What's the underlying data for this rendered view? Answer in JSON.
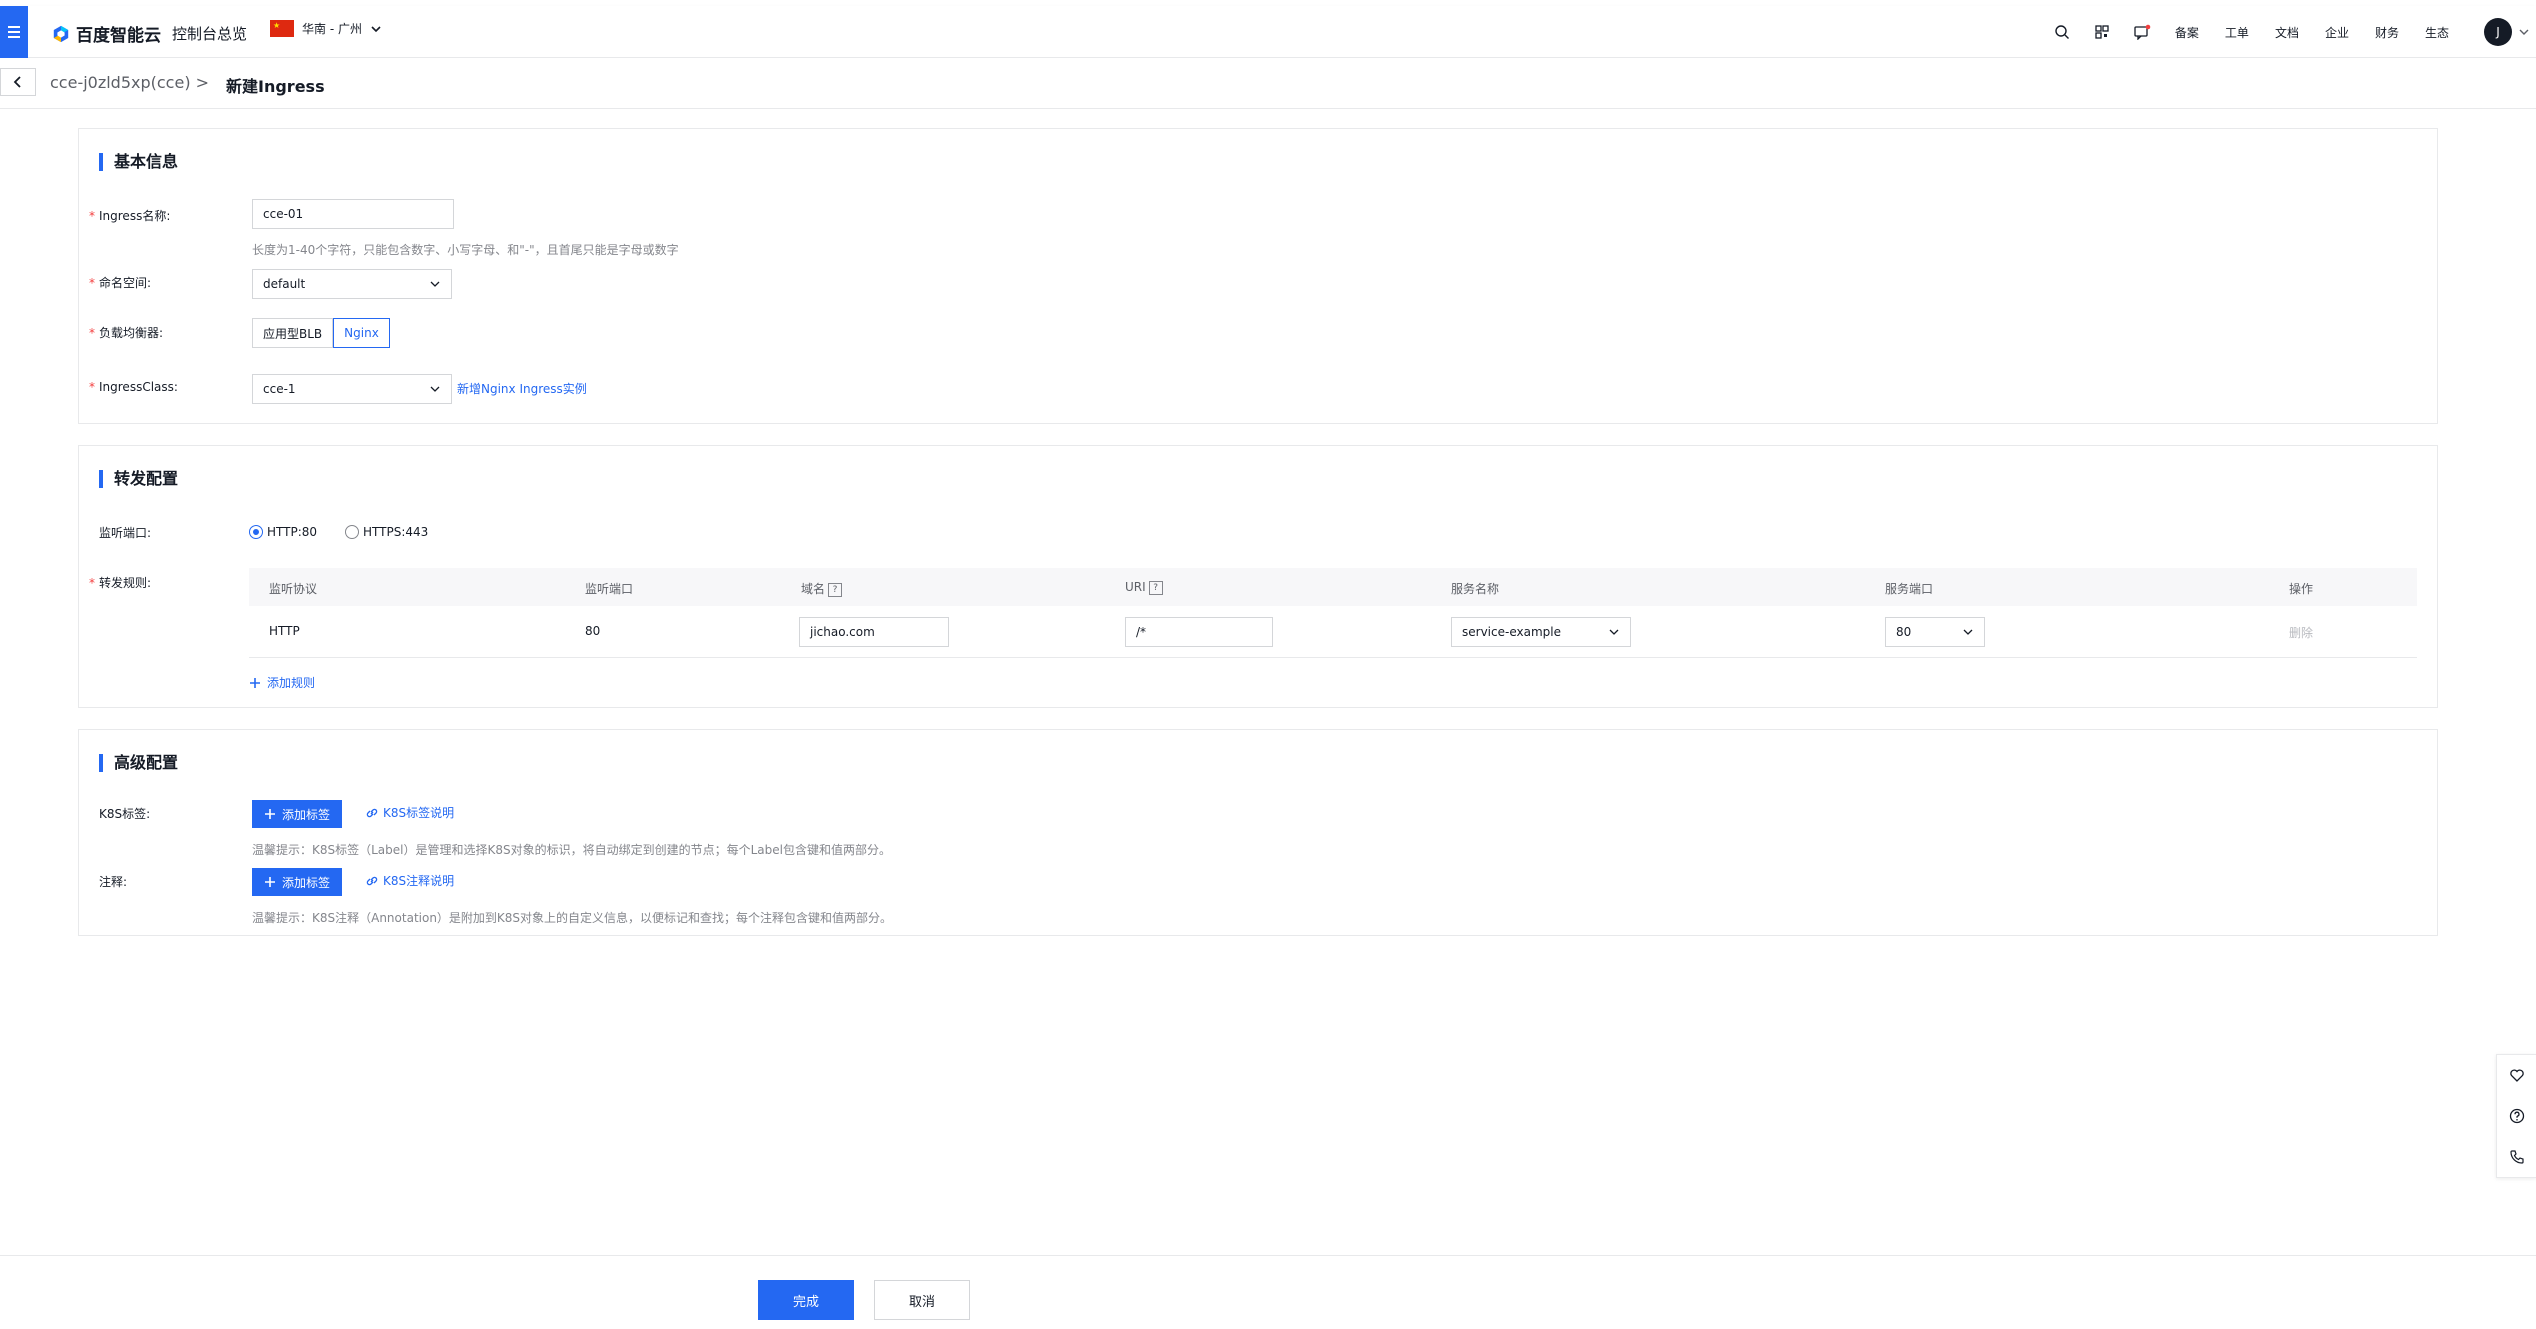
{
  "topbar": {
    "brand": "百度智能云",
    "console": "控制台总览",
    "region": "华南 - 广州",
    "links": [
      "备案",
      "工单",
      "文档",
      "企业",
      "财务",
      "生态"
    ],
    "avatar": "J",
    "icons": [
      "search-icon",
      "qrcode-icon",
      "message-icon"
    ]
  },
  "breadcrumb": {
    "parent": "cce-j0zld5xp(cce) >",
    "current": "新建Ingress"
  },
  "basic": {
    "title": "基本信息",
    "name_label": "Ingress名称:",
    "name_value": "cce-01",
    "name_hint": "长度为1-40个字符，只能包含数字、小写字母、和\"-\"，且首尾只能是字母或数字",
    "ns_label": "命名空间:",
    "ns_value": "default",
    "lb_label": "负载均衡器:",
    "lb_options": [
      "应用型BLB",
      "Nginx"
    ],
    "lb_selected": "Nginx",
    "class_label": "IngressClass:",
    "class_value": "cce-1",
    "class_link": "新增Nginx Ingress实例"
  },
  "forward": {
    "title": "转发配置",
    "port_label": "监听端口:",
    "ports": [
      "HTTP:80",
      "HTTPS:443"
    ],
    "port_selected": "HTTP:80",
    "rules_label": "转发规则:",
    "columns": [
      "监听协议",
      "监听端口",
      "域名",
      "URI",
      "服务名称",
      "服务端口",
      "操作"
    ],
    "row": {
      "protocol": "HTTP",
      "port": "80",
      "domain": "jichao.com",
      "uri": "/*",
      "service": "service-example",
      "service_port": "80",
      "action": "删除"
    },
    "add_rule": "添加规则"
  },
  "advanced": {
    "title": "高级配置",
    "k8s_label": "K8S标签:",
    "add_tag": "添加标签",
    "k8s_link": "K8S标签说明",
    "k8s_hint": "温馨提示：K8S标签（Label）是管理和选择K8S对象的标识，将自动绑定到创建的节点；每个Label包含键和值两部分。",
    "anno_label": "注释:",
    "anno_add": "添加标签",
    "anno_link": "K8S注释说明",
    "anno_hint": "温馨提示：K8S注释（Annotation）是附加到K8S对象上的自定义信息，以便标记和查找；每个注释包含键和值两部分。"
  },
  "footer": {
    "ok": "完成",
    "cancel": "取消"
  },
  "colors": {
    "primary": "#2468f2",
    "required": "#f33e3e"
  }
}
